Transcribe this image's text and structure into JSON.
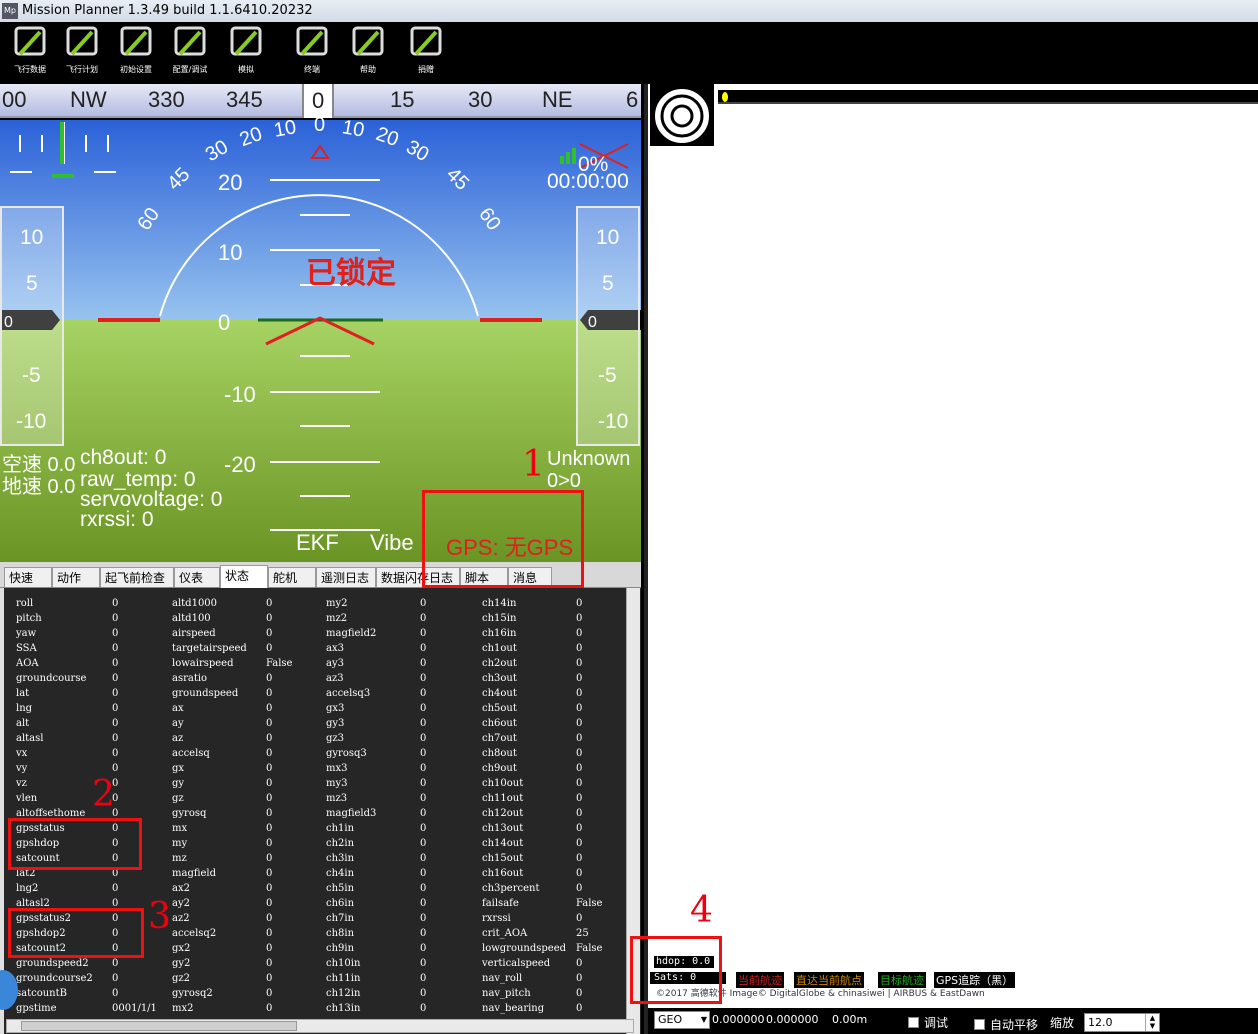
{
  "window": {
    "title": "Mission Planner 1.3.49 build 1.1.6410.20232",
    "icon_text": "Mp"
  },
  "toolbar": [
    {
      "label": "飞行数据",
      "icon": "flight-data-icon"
    },
    {
      "label": "飞行计划",
      "icon": "flight-plan-icon"
    },
    {
      "label": "初始设置",
      "icon": "initial-setup-icon"
    },
    {
      "label": "配置/调试",
      "icon": "config-tuning-icon"
    },
    {
      "label": "模拟",
      "icon": "simulation-icon"
    },
    {
      "label": "终端",
      "icon": "terminal-icon"
    },
    {
      "label": "帮助",
      "icon": "help-icon"
    },
    {
      "label": "捐赠",
      "icon": "donate-icon"
    }
  ],
  "hud": {
    "compass": [
      "00",
      "NW",
      "330",
      "345",
      "0",
      "15",
      "30",
      "NE",
      "6"
    ],
    "roll_marks": [
      "60",
      "45",
      "30",
      "20",
      "10",
      "0",
      "10",
      "20",
      "30",
      "45",
      "60"
    ],
    "pitch_marks": [
      "20",
      "10",
      "0",
      "-10",
      "-20"
    ],
    "speed_tape": [
      "10",
      "5",
      "0",
      "-5",
      "-10"
    ],
    "alt_tape": [
      "10",
      "5",
      "0",
      "-5",
      "-10"
    ],
    "battery": "0%",
    "timer": "00:00:00",
    "armed_text": "已锁定",
    "airspeed": "空速 0.0",
    "groundspeed": "地速 0.0",
    "ch8out": "ch8out: 0",
    "raw_temp": "raw_temp: 0",
    "servovoltage": "servovoltage: 0",
    "rxrssi": "rxrssi: 0",
    "mode": "Unknown",
    "wp": "0>0",
    "ekf": "EKF",
    "vibe": "Vibe",
    "gps": "GPS: 无GPS"
  },
  "tabs": [
    "快速",
    "动作",
    "起飞前检查",
    "仪表",
    "状态",
    "舵机",
    "遥测日志",
    "数据闪存日志",
    "脚本",
    "消息"
  ],
  "active_tab": "状态",
  "status_columns": [
    [
      [
        "roll",
        "0"
      ],
      [
        "pitch",
        "0"
      ],
      [
        "yaw",
        "0"
      ],
      [
        "SSA",
        "0"
      ],
      [
        "AOA",
        "0"
      ],
      [
        "groundcourse",
        "0"
      ],
      [
        "lat",
        "0"
      ],
      [
        "lng",
        "0"
      ],
      [
        "alt",
        "0"
      ],
      [
        "altasl",
        "0"
      ],
      [
        "vx",
        "0"
      ],
      [
        "vy",
        "0"
      ],
      [
        "vz",
        "0"
      ],
      [
        "vlen",
        "0"
      ],
      [
        "altoffsethome",
        "0"
      ],
      [
        "gpsstatus",
        "0"
      ],
      [
        "gpshdop",
        "0"
      ],
      [
        "satcount",
        "0"
      ],
      [
        "lat2",
        "0"
      ],
      [
        "lng2",
        "0"
      ],
      [
        "altasl2",
        "0"
      ],
      [
        "gpsstatus2",
        "0"
      ],
      [
        "gpshdop2",
        "0"
      ],
      [
        "satcount2",
        "0"
      ],
      [
        "groundspeed2",
        "0"
      ],
      [
        "groundcourse2",
        "0"
      ],
      [
        "satcountB",
        "0"
      ],
      [
        "gpstime",
        "0001/1/1"
      ]
    ],
    [
      [
        "altd1000",
        "0"
      ],
      [
        "altd100",
        "0"
      ],
      [
        "airspeed",
        "0"
      ],
      [
        "targetairspeed",
        "0"
      ],
      [
        "lowairspeed",
        "False"
      ],
      [
        "asratio",
        "0"
      ],
      [
        "groundspeed",
        "0"
      ],
      [
        "ax",
        "0"
      ],
      [
        "ay",
        "0"
      ],
      [
        "az",
        "0"
      ],
      [
        "accelsq",
        "0"
      ],
      [
        "gx",
        "0"
      ],
      [
        "gy",
        "0"
      ],
      [
        "gz",
        "0"
      ],
      [
        "gyrosq",
        "0"
      ],
      [
        "mx",
        "0"
      ],
      [
        "my",
        "0"
      ],
      [
        "mz",
        "0"
      ],
      [
        "magfield",
        "0"
      ],
      [
        "ax2",
        "0"
      ],
      [
        "ay2",
        "0"
      ],
      [
        "az2",
        "0"
      ],
      [
        "accelsq2",
        "0"
      ],
      [
        "gx2",
        "0"
      ],
      [
        "gy2",
        "0"
      ],
      [
        "gz2",
        "0"
      ],
      [
        "gyrosq2",
        "0"
      ],
      [
        "mx2",
        "0"
      ]
    ],
    [
      [
        "my2",
        "0"
      ],
      [
        "mz2",
        "0"
      ],
      [
        "magfield2",
        "0"
      ],
      [
        "ax3",
        "0"
      ],
      [
        "ay3",
        "0"
      ],
      [
        "az3",
        "0"
      ],
      [
        "accelsq3",
        "0"
      ],
      [
        "gx3",
        "0"
      ],
      [
        "gy3",
        "0"
      ],
      [
        "gz3",
        "0"
      ],
      [
        "gyrosq3",
        "0"
      ],
      [
        "mx3",
        "0"
      ],
      [
        "my3",
        "0"
      ],
      [
        "mz3",
        "0"
      ],
      [
        "magfield3",
        "0"
      ],
      [
        "ch1in",
        "0"
      ],
      [
        "ch2in",
        "0"
      ],
      [
        "ch3in",
        "0"
      ],
      [
        "ch4in",
        "0"
      ],
      [
        "ch5in",
        "0"
      ],
      [
        "ch6in",
        "0"
      ],
      [
        "ch7in",
        "0"
      ],
      [
        "ch8in",
        "0"
      ],
      [
        "ch9in",
        "0"
      ],
      [
        "ch10in",
        "0"
      ],
      [
        "ch11in",
        "0"
      ],
      [
        "ch12in",
        "0"
      ],
      [
        "ch13in",
        "0"
      ]
    ],
    [
      [
        "ch14in",
        "0"
      ],
      [
        "ch15in",
        "0"
      ],
      [
        "ch16in",
        "0"
      ],
      [
        "ch1out",
        "0"
      ],
      [
        "ch2out",
        "0"
      ],
      [
        "ch3out",
        "0"
      ],
      [
        "ch4out",
        "0"
      ],
      [
        "ch5out",
        "0"
      ],
      [
        "ch6out",
        "0"
      ],
      [
        "ch7out",
        "0"
      ],
      [
        "ch8out",
        "0"
      ],
      [
        "ch9out",
        "0"
      ],
      [
        "ch10out",
        "0"
      ],
      [
        "ch11out",
        "0"
      ],
      [
        "ch12out",
        "0"
      ],
      [
        "ch13out",
        "0"
      ],
      [
        "ch14out",
        "0"
      ],
      [
        "ch15out",
        "0"
      ],
      [
        "ch16out",
        "0"
      ],
      [
        "ch3percent",
        "0"
      ],
      [
        "failsafe",
        "False"
      ],
      [
        "rxrssi",
        "0"
      ],
      [
        "crit_AOA",
        "25"
      ],
      [
        "lowgroundspeed",
        "False"
      ],
      [
        "verticalspeed",
        "0"
      ],
      [
        "nav_roll",
        "0"
      ],
      [
        "nav_pitch",
        "0"
      ],
      [
        "nav_bearing",
        "0"
      ]
    ]
  ],
  "annotations": [
    "1",
    "2",
    "3",
    "4"
  ],
  "map": {
    "hdop": "hdop: 0.0",
    "sats": "Sats: 0",
    "btn_current_wp": "当前航迹",
    "btn_direct_wp": "直达当前航点",
    "btn_home_track": "目标航迹",
    "btn_gps_track": "GPS追踪（黑）",
    "copyright": "©2017 高德软件 Image© DigitalGlobe & chinasiwei | AIRBUS & EastDawn",
    "geo": "GEO",
    "lat": "0.000000",
    "lng": "0.000000",
    "alt": "0.00m",
    "debug_label": "调试",
    "autopan_label": "自动平移",
    "zoom_label": "缩放",
    "zoom_value": "12.0"
  },
  "colors": {
    "armed_red": "#e0201a",
    "gps_red": "#e02020",
    "annotation_red": "#e11111"
  }
}
